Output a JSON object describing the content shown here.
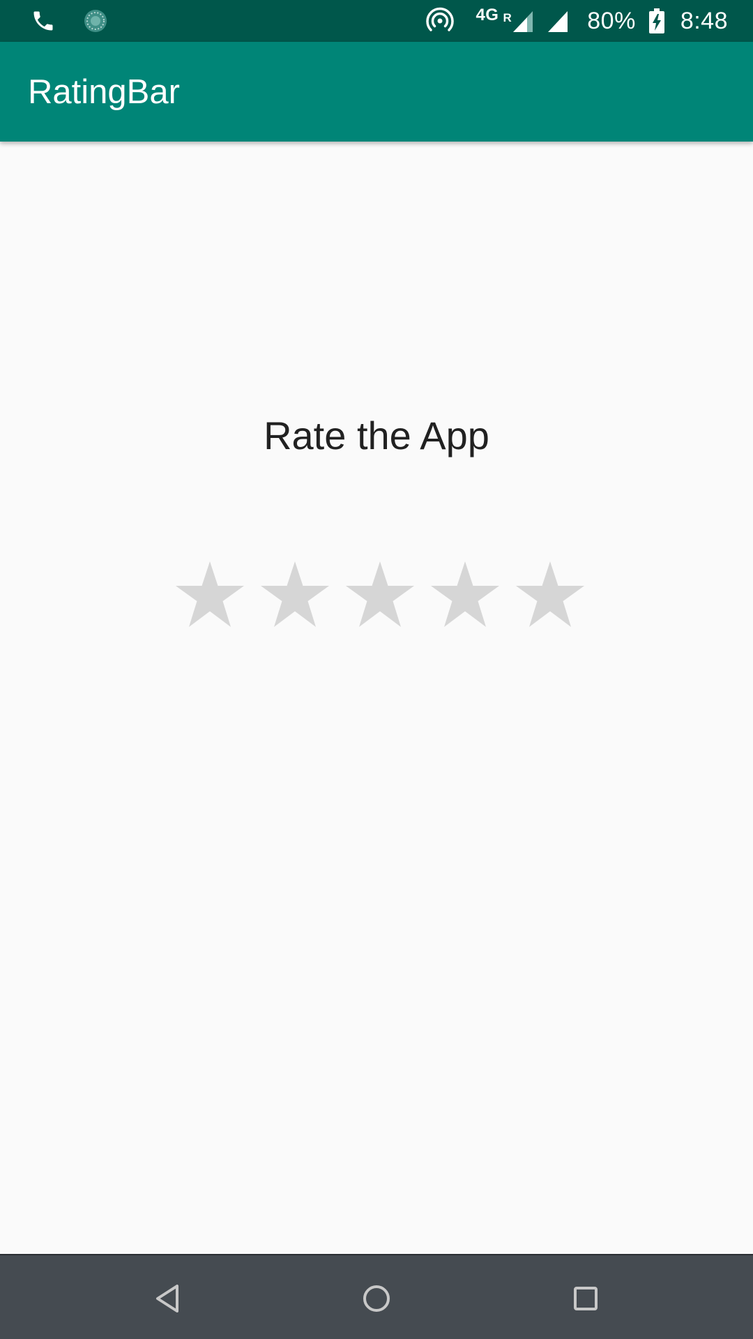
{
  "status_bar": {
    "network_type": "4G",
    "roaming_label": "R",
    "battery_percent": "80%",
    "time": "8:48",
    "icons": [
      "phone-icon",
      "sync-icon",
      "hotspot-icon",
      "signal-roaming-icon",
      "signal-icon",
      "battery-charging-icon"
    ]
  },
  "app_bar": {
    "title": "RatingBar"
  },
  "main": {
    "heading": "Rate the App",
    "rating": {
      "max_stars": 5,
      "value": 0,
      "empty_color": "#d6d6d6"
    }
  },
  "nav_bar": {
    "buttons": [
      "back-icon",
      "home-icon",
      "recents-icon"
    ]
  },
  "colors": {
    "status_bar": "#00574b",
    "primary": "#008577",
    "background": "#fafafa",
    "nav_bar": "#454b51"
  }
}
